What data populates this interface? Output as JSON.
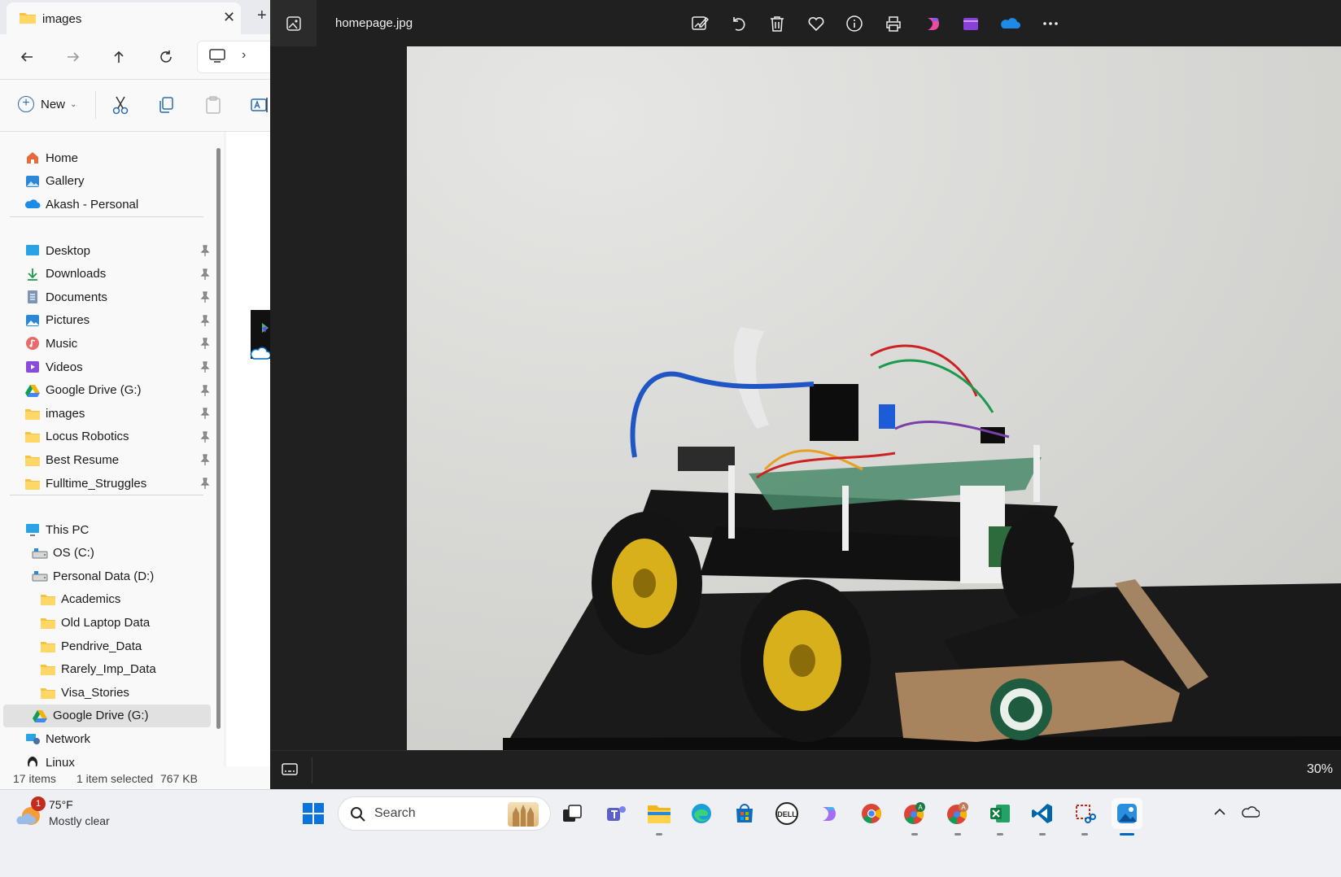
{
  "explorer": {
    "tab_title": "images",
    "new_label": "New",
    "nav_quick": [
      {
        "label": "Home",
        "icon": "home-icon"
      },
      {
        "label": "Gallery",
        "icon": "gallery-icon"
      },
      {
        "label": "Akash - Personal",
        "icon": "onedrive-icon"
      }
    ],
    "nav_pinned": [
      {
        "label": "Desktop",
        "icon": "desktop-icon"
      },
      {
        "label": "Downloads",
        "icon": "download-icon"
      },
      {
        "label": "Documents",
        "icon": "document-icon"
      },
      {
        "label": "Pictures",
        "icon": "pictures-icon"
      },
      {
        "label": "Music",
        "icon": "music-icon"
      },
      {
        "label": "Videos",
        "icon": "video-icon"
      },
      {
        "label": "Google Drive (G:)",
        "icon": "google-drive-icon"
      },
      {
        "label": "images",
        "icon": "folder-icon"
      },
      {
        "label": "Locus Robotics",
        "icon": "folder-icon"
      },
      {
        "label": "Best Resume",
        "icon": "folder-icon"
      },
      {
        "label": "Fulltime_Struggles",
        "icon": "folder-icon"
      }
    ],
    "nav_pc": [
      {
        "label": "This PC",
        "icon": "pc-icon",
        "indent": 0
      },
      {
        "label": "OS (C:)",
        "icon": "drive-icon",
        "indent": 1
      },
      {
        "label": "Personal Data (D:)",
        "icon": "drive-icon",
        "indent": 1
      },
      {
        "label": "Academics",
        "icon": "folder-icon",
        "indent": 2
      },
      {
        "label": "Old Laptop Data",
        "icon": "folder-icon",
        "indent": 2
      },
      {
        "label": "Pendrive_Data",
        "icon": "folder-icon",
        "indent": 2
      },
      {
        "label": "Rarely_Imp_Data",
        "icon": "folder-icon",
        "indent": 2
      },
      {
        "label": "Visa_Stories",
        "icon": "folder-icon",
        "indent": 2
      },
      {
        "label": "Google Drive (G:)",
        "icon": "google-drive-icon",
        "indent": 1,
        "selected": true
      },
      {
        "label": "Network",
        "icon": "network-icon",
        "indent": 0
      },
      {
        "label": "Linux",
        "icon": "linux-icon",
        "indent": 0
      }
    ],
    "status": {
      "items": "17 items",
      "selected": "1 item selected",
      "size": "767 KB"
    }
  },
  "viewer": {
    "filename": "homepage.jpg",
    "zoom": "30%",
    "tools": [
      "edit-image-icon",
      "rotate-icon",
      "delete-icon",
      "favorite-icon",
      "info-icon",
      "print-icon",
      "copilot-icon",
      "clipchamp-icon",
      "onedrive-icon",
      "more-options-icon"
    ]
  },
  "taskbar": {
    "weather_temp": "75°F",
    "weather_desc": "Mostly clear",
    "weather_badge": "1",
    "search_label": "Search",
    "apps": [
      "start-icon",
      "task-view-icon",
      "teams-icon",
      "file-explorer-icon",
      "edge-icon",
      "store-icon",
      "dell-icon",
      "copilot-icon",
      "chrome-icon",
      "chrome-profile-a-icon",
      "chrome-profile-icon",
      "excel-icon",
      "vscode-icon",
      "snipping-tool-icon",
      "photos-icon"
    ]
  },
  "colors": {
    "accent": "#0067c0",
    "viewer_bg": "#202020",
    "selection": "#e1e1e1"
  }
}
